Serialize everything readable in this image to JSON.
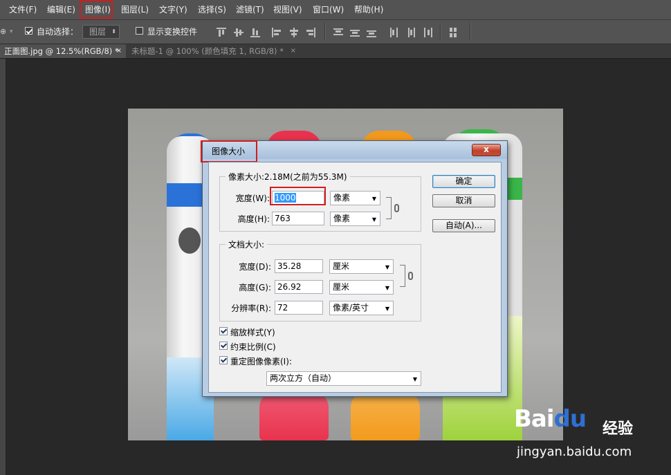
{
  "menubar": {
    "items": [
      "文件(F)",
      "编辑(E)",
      "图像(I)",
      "图层(L)",
      "文字(Y)",
      "选择(S)",
      "滤镜(T)",
      "视图(V)",
      "窗口(W)",
      "帮助(H)"
    ]
  },
  "options_bar": {
    "auto_select_label": "自动选择：",
    "auto_select_value": "图层",
    "show_transform_label": "显示变换控件"
  },
  "tabs": [
    {
      "label": "正面图.jpg @ 12.5%(RGB/8) *",
      "close": "×"
    },
    {
      "label": "未标题-1 @ 100% (颜色填充 1, RGB/8) *",
      "close": "×"
    }
  ],
  "dialog": {
    "title": "图像大小",
    "close": "x",
    "pixel_group": {
      "legend": "像素大小:2.18M(之前为55.3M)",
      "width_label": "宽度(W):",
      "width_value": "1000",
      "width_unit": "像素",
      "height_label": "高度(H):",
      "height_value": "763",
      "height_unit": "像素"
    },
    "doc_group": {
      "legend": "文档大小:",
      "width_label": "宽度(D):",
      "width_value": "35.28",
      "width_unit": "厘米",
      "height_label": "高度(G):",
      "height_value": "26.92",
      "height_unit": "厘米",
      "res_label": "分辨率(R):",
      "res_value": "72",
      "res_unit": "像素/英寸"
    },
    "checkboxes": {
      "scale_styles": "缩放样式(Y)",
      "constrain": "约束比例(C)",
      "resample": "重定图像像素(I):"
    },
    "resample_method": "两次立方（自动）",
    "buttons": {
      "ok": "确定",
      "cancel": "取消",
      "auto": "自动(A)..."
    }
  },
  "watermark": {
    "logo_bai": "Bai",
    "logo_du": "du",
    "jingyan": "经验",
    "url": "jingyan.baidu.com"
  },
  "colors": {
    "highlight": "#d21c1c",
    "bottle_blue": "#2a72d8",
    "bottle_red": "#e8334e",
    "bottle_orange": "#f29a1d",
    "bottle_green": "#3ab54a"
  }
}
